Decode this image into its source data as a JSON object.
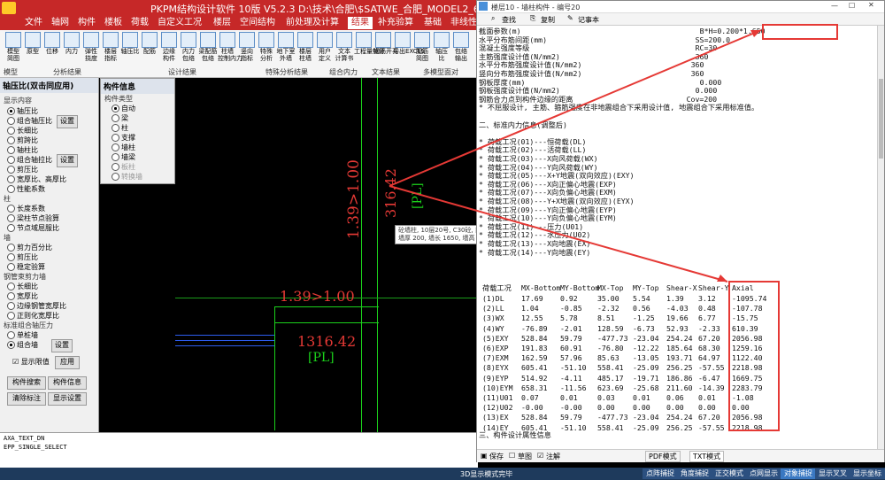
{
  "app": {
    "title": "PKPM结构设计软件 10版 V5.2.3 D:\\技术\\合肥\\$SATWE_合肥_MODEL2_6"
  },
  "menu": [
    "文件",
    "轴网",
    "构件",
    "楼板",
    "荷载",
    "自定义工况",
    "楼层",
    "空间结构",
    "前处理及计算",
    "结果",
    "补充验算",
    "基础",
    "非线性",
    "砼施工图"
  ],
  "ribbon": {
    "buttons": [
      "模型\n简图",
      "原型",
      "位移",
      "内力",
      "弹性\n挠度",
      "楼层\n指标",
      "轴压比",
      "配筋",
      "边缘\n构件",
      "内力\n包络",
      "梁配筋\n包络",
      "柱墙\n控制内力",
      "竖向\n指标",
      "特殊\n分析",
      "地下室\n外墙",
      "楼层\n柱墙",
      "用户\n定义",
      "文本\n计算书",
      "工程量统计",
      "钢筋开孔",
      "导出EXCEL",
      "配筋\n简图",
      "轴压\n比",
      "包络\n输出"
    ],
    "groups": [
      "模型",
      "分析结果",
      "设计结果",
      "特殊分析结果",
      "组合内力",
      "文本结果",
      "多模型面对"
    ]
  },
  "left_panel": {
    "title": "轴压比(双击同应用)",
    "display_title": "显示内容",
    "options": [
      "轴压比",
      "组合轴压比",
      "长细比",
      "剪跨比",
      "轴柱比",
      "组合轴拉比",
      "剪压比",
      "宽厚比、高厚比",
      "性能系数"
    ],
    "setting_label": "设置",
    "column_title": "柱",
    "column_options": [
      "长度系数",
      "梁柱节点验算",
      "节点域屈服比"
    ],
    "wall_title": "墙",
    "wall_options": [
      "剪力百分比",
      "剪压比",
      "稳定验算"
    ],
    "steel_title": "钢管束剪力墙",
    "steel_options": [
      "长细比",
      "宽厚比",
      "边缘钢管宽厚比",
      "正则化宽厚比"
    ],
    "combo_title": "标准组合轴压力",
    "combo_options": [
      "单桩墙",
      "组合墙"
    ],
    "show_limit": "显示限值",
    "apply": "应用",
    "btn_search": "构件搜索",
    "btn_info": "构件信息",
    "btn_clear": "清除标注",
    "btn_show": "显示设置"
  },
  "info_panel": {
    "title": "构件信息",
    "type_title": "构件类型",
    "types": [
      "自动",
      "梁",
      "柱",
      "支撑",
      "墙柱",
      "墙梁",
      "板柱",
      "转换墙"
    ]
  },
  "cad": {
    "ratio_vertical": "1.39>1.00",
    "ratio_horizontal": "1.39>1.00",
    "value_vertical": "316.42",
    "value_horizontal": "1316.42",
    "pl": "[PL]",
    "tooltip": "砼墙柱, 10层20号, C30砼, 前节点 3609,3608,4009,4007\n墙厚 200, 墙长 1650, 墙高 2900"
  },
  "command": [
    "AXA_TEXT_DN",
    "EPP_SINGLE_SELECT"
  ],
  "statusbar": {
    "left": "3D显示模式完毕",
    "buttons": [
      "点阵捕捉",
      "角度捕捉",
      "正交模式",
      "点网显示",
      "对象捕捉",
      "显示叉叉",
      "显示坐标"
    ]
  },
  "notepad": {
    "title": "楼层10 - 墙柱构件 - 编号20",
    "tools": [
      "查找",
      "复制",
      "记事本"
    ],
    "lines": [
      "截面参数(m)                                         B*H=0.200*1.650",
      "水平分布筋间距(mm)                                  SS=200.0",
      "混凝土强度等级                                      RC=30",
      "主筋强度设计值(N/mm2)                               360",
      "水平分布筋强度设计值(N/mm2)                         360",
      "竖向分布筋强度设计值(N/mm2)                         360",
      "钢板厚度(mm)                                        0.000",
      "钢板强度设计值(N/mm2)                               0.000",
      "钢筋合力点到构件边缘的距离                          Cov=200",
      "* 不屈服设计, 主筋、箍筋强度在非地震组合下采用设计值, 地震组合下采用标准值。",
      "",
      "二、标准内力信息(调整后)",
      "",
      "* 荷载工况(01)---恒荷载(DL)",
      "* 荷载工况(02)---活荷载(LL)",
      "* 荷载工况(03)---X向风荷载(WX)",
      "* 荷载工况(04)---Y向风荷载(WY)",
      "* 荷载工况(05)---X+Y地震(双向效应)(EXY)",
      "* 荷载工况(06)---X向正偏心地震(EXP)",
      "* 荷载工况(07)---X向负偏心地震(EXM)",
      "* 荷载工况(08)---Y+X地震(双向效应)(EYX)",
      "* 荷载工况(09)---Y向正偏心地震(EYP)",
      "* 荷载工况(10)---Y向负偏心地震(EYM)",
      "* 荷载工况(11)---压力(U01)",
      "* 荷载工况(12)---水压力(U02)",
      "* 荷载工况(13)---X向地震(EX)",
      "* 荷载工况(14)---Y向地震(EY)"
    ],
    "table_header": [
      "荷载工况",
      "MX-Bottom",
      "MY-Bottom",
      "MX-Top",
      "MY-Top",
      "Shear-X",
      "Shear-Y",
      "Axial"
    ],
    "table_rows": [
      [
        "(1)DL",
        "17.69",
        "0.92",
        "35.00",
        "5.54",
        "1.39",
        "3.12",
        "-1095.74"
      ],
      [
        "(2)LL",
        "1.04",
        "-0.85",
        "-2.32",
        "0.56",
        "-4.03",
        "0.48",
        "-107.78"
      ],
      [
        "(3)WX",
        "12.55",
        "5.78",
        "8.51",
        "-1.25",
        "19.66",
        "6.77",
        "-15.75"
      ],
      [
        "(4)WY",
        "-76.89",
        "-2.01",
        "128.59",
        "-6.73",
        "52.93",
        "-2.33",
        "610.39"
      ],
      [
        "(5)EXY",
        "528.84",
        "59.79",
        "-477.73",
        "-23.04",
        "254.24",
        "67.20",
        "2056.98"
      ],
      [
        "(6)EXP",
        "191.83",
        "60.91",
        "-76.80",
        "-12.22",
        "185.64",
        "68.30",
        "1259.16"
      ],
      [
        "(7)EXM",
        "162.59",
        "57.96",
        "85.63",
        "-13.05",
        "193.71",
        "64.97",
        "1122.40"
      ],
      [
        "(8)EYX",
        "605.41",
        "-51.10",
        "558.41",
        "-25.09",
        "256.25",
        "-57.55",
        "2218.98"
      ],
      [
        "(9)EYP",
        "514.92",
        "-4.11",
        "485.17",
        "-19.71",
        "186.86",
        "-6.47",
        "1669.75"
      ],
      [
        "(10)EYM",
        "658.31",
        "-11.56",
        "623.69",
        "-25.68",
        "211.60",
        "-14.39",
        "2283.79"
      ],
      [
        "(11)U01",
        "0.07",
        "0.01",
        "0.03",
        "0.01",
        "0.06",
        "0.01",
        "-1.08"
      ],
      [
        "(12)U02",
        "-0.00",
        "-0.00",
        "0.00",
        "0.00",
        "0.00",
        "0.00",
        "0.00"
      ],
      [
        "(13)EX",
        "528.84",
        "59.79",
        "-477.73",
        "-23.04",
        "254.24",
        "67.20",
        "2056.98"
      ],
      [
        "(14)EY",
        "605.41",
        "-51.10",
        "558.41",
        "-25.09",
        "256.25",
        "-57.55",
        "2218.98"
      ]
    ],
    "footer_title": "三、构件设计属性信息",
    "bottom": [
      "保存",
      "草图",
      "注解",
      "PDF模式",
      "TXT模式"
    ]
  }
}
